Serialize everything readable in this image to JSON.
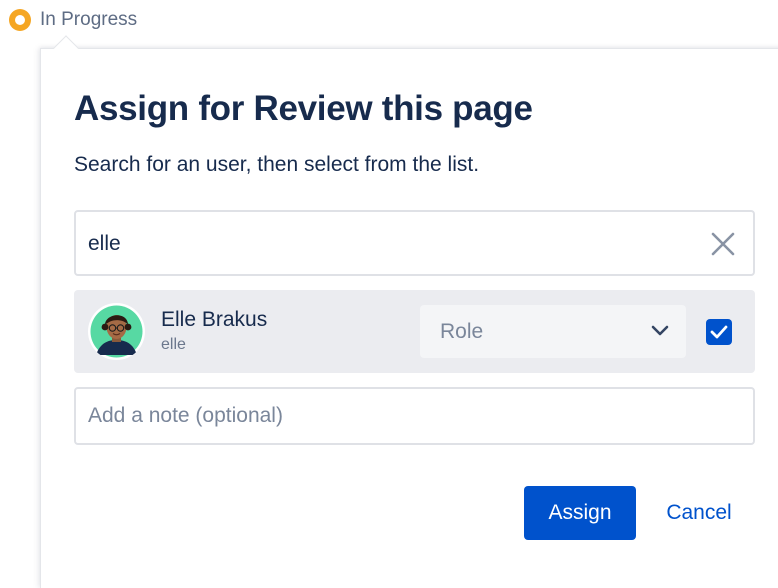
{
  "status": {
    "label": "In Progress",
    "color": "#f5a623",
    "icon": "status-circle-icon"
  },
  "dialog": {
    "title": "Assign for Review this page",
    "subtitle": "Search for an user, then select from the list."
  },
  "search": {
    "value": "elle",
    "clear_icon": "close-icon"
  },
  "result": {
    "name": "Elle Brakus",
    "handle": "elle",
    "avatar_icon": "user-avatar",
    "role_placeholder": "Role",
    "role_icon": "chevron-down-icon",
    "selected": true
  },
  "note": {
    "placeholder": "Add a note (optional)",
    "value": ""
  },
  "actions": {
    "assign_label": "Assign",
    "cancel_label": "Cancel"
  },
  "colors": {
    "primary": "#0052cc",
    "text": "#172b4d",
    "row_bg": "#ebecf0",
    "status": "#f5a623"
  }
}
